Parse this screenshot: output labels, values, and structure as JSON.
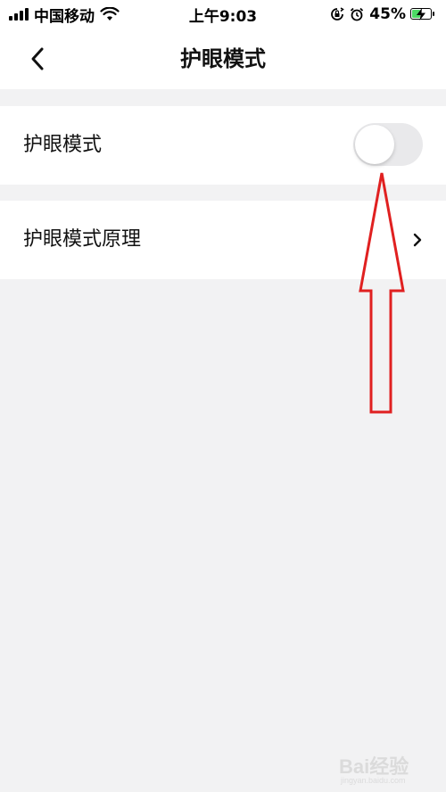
{
  "status_bar": {
    "carrier": "中国移动",
    "time": "上午9:03",
    "battery_percent_text": "45%",
    "battery_level": 0.45,
    "icons": [
      "signal-icon",
      "wifi-icon",
      "rotation-lock-icon",
      "alarm-icon",
      "battery-icon"
    ]
  },
  "nav": {
    "title": "护眼模式",
    "back_icon": "chevron-left-icon"
  },
  "settings": {
    "eye_mode": {
      "label": "护眼模式",
      "enabled": false
    },
    "principle": {
      "label": "护眼模式原理",
      "icon": "chevron-right-icon"
    }
  },
  "annotation": {
    "type": "arrow",
    "color": "#e02020",
    "points_to": "eye-mode-toggle"
  },
  "watermark": {
    "text": "Bai经验",
    "sub": "jingyan.baidu.com"
  },
  "colors": {
    "background": "#f2f2f3",
    "card": "#ffffff",
    "toggle_off": "#e9e9eb",
    "battery_fill": "#4cd964",
    "annotation": "#e02020"
  }
}
